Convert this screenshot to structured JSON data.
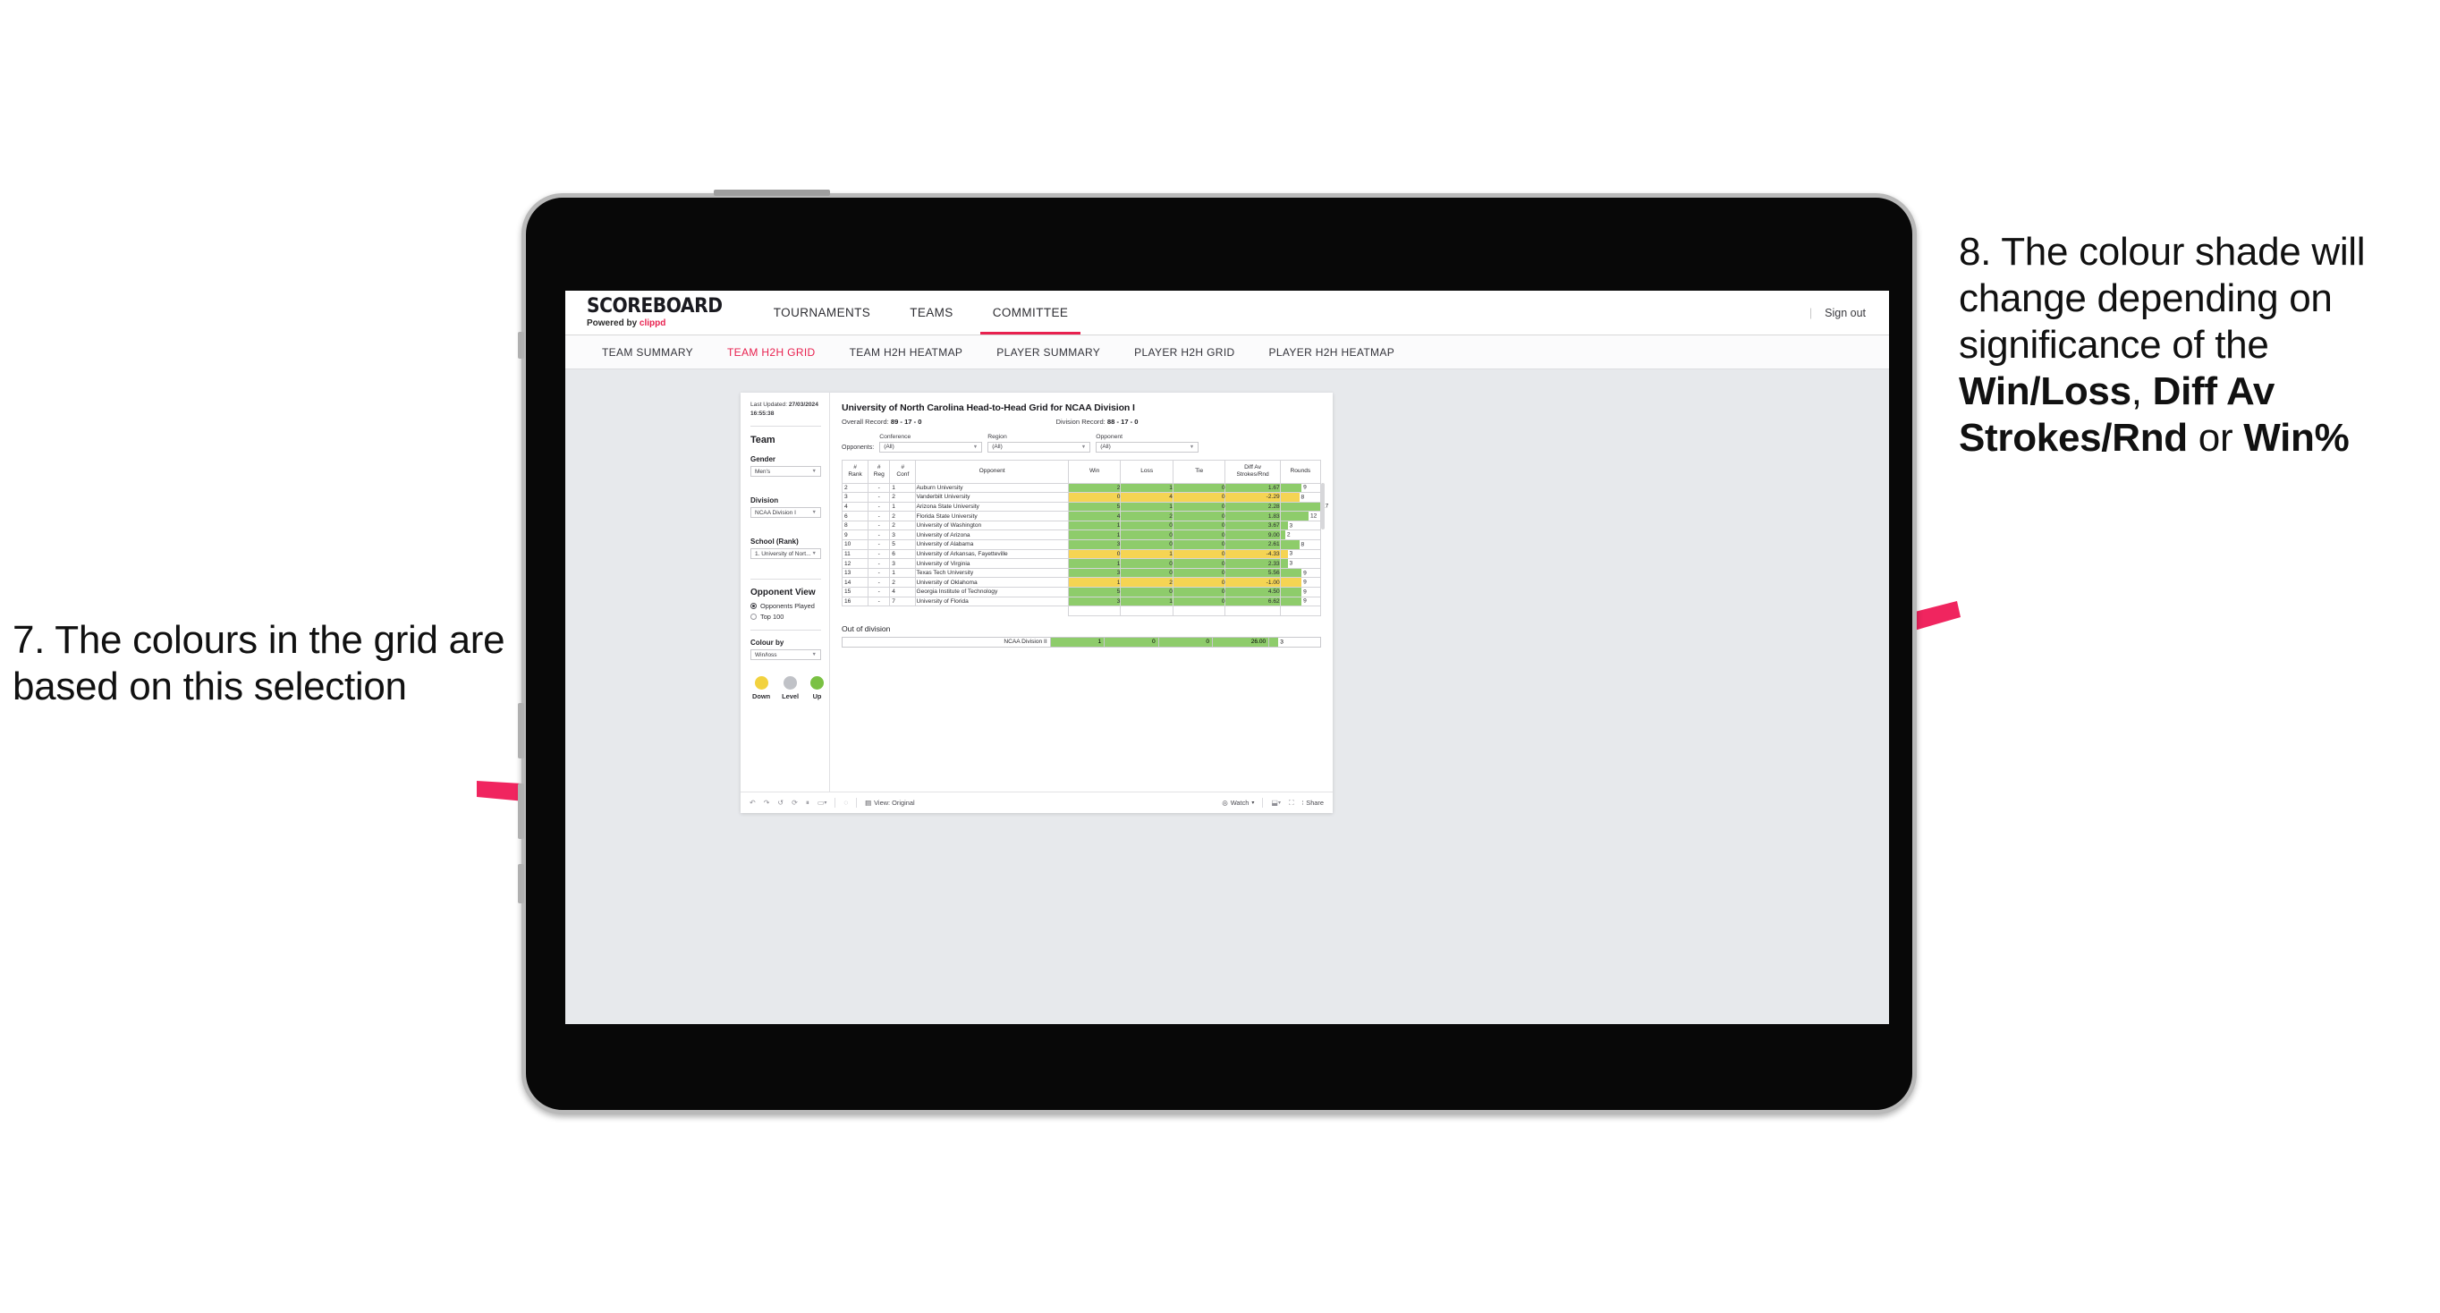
{
  "annotations": {
    "left": {
      "num": "7.",
      "text": "The colours in the grid are based on this selection"
    },
    "right_parts": [
      {
        "t": "8. The colour shade will change depending on significance of the ",
        "b": false
      },
      {
        "t": "Win/Loss",
        "b": true
      },
      {
        "t": ", ",
        "b": false
      },
      {
        "t": "Diff Av Strokes/Rnd",
        "b": true
      },
      {
        "t": " or ",
        "b": false
      },
      {
        "t": "Win%",
        "b": true
      }
    ],
    "arrow_color": "#F0255F"
  },
  "app": {
    "logo_main": "SCOREBOARD",
    "logo_sub_prefix": "Powered by ",
    "logo_brand": "clippd",
    "topnav": [
      {
        "label": "TOURNAMENTS",
        "active": false
      },
      {
        "label": "TEAMS",
        "active": false
      },
      {
        "label": "COMMITTEE",
        "active": true
      }
    ],
    "signout_divider": "|",
    "signout": "Sign out",
    "subnav": [
      {
        "label": "TEAM SUMMARY",
        "active": false
      },
      {
        "label": "TEAM H2H GRID",
        "active": true
      },
      {
        "label": "TEAM H2H HEATMAP",
        "active": false
      },
      {
        "label": "PLAYER SUMMARY",
        "active": false
      },
      {
        "label": "PLAYER H2H GRID",
        "active": false
      },
      {
        "label": "PLAYER H2H HEATMAP",
        "active": false
      }
    ],
    "accent": "#e8214f"
  },
  "sidebar": {
    "updated_label": "Last Updated: ",
    "updated_date": "27/03/2024",
    "updated_time": "16:55:38",
    "team_heading": "Team",
    "gender_label": "Gender",
    "gender_value": "Men's",
    "division_label": "Division",
    "division_value": "NCAA Division I",
    "school_label": "School (Rank)",
    "school_value": "1. University of Nort...",
    "opponent_view_heading": "Opponent View",
    "radios": [
      {
        "label": "Opponents Played",
        "selected": true
      },
      {
        "label": "Top 100",
        "selected": false
      }
    ],
    "colour_by_label": "Colour by",
    "colour_by_value": "Win/loss",
    "legend": [
      {
        "label": "Down",
        "color": "#f2d23f"
      },
      {
        "label": "Level",
        "color": "#c0c2c7"
      },
      {
        "label": "Up",
        "color": "#7ac143"
      }
    ]
  },
  "workbook": {
    "title": "University of North Carolina Head-to-Head Grid for NCAA Division I",
    "overall_label": "Overall Record: ",
    "overall_value": "89 - 17 - 0",
    "division_label": "Division Record: ",
    "division_value": "88 - 17 - 0",
    "opponents_label": "Opponents:",
    "filters": [
      {
        "label": "Conference",
        "value": "(All)"
      },
      {
        "label": "Region",
        "value": "(All)"
      },
      {
        "label": "Opponent",
        "value": "(All)"
      }
    ],
    "out_of_division_title": "Out of division",
    "toolbar": {
      "view_label": "View: Original",
      "watch_label": "Watch",
      "share_label": "Share"
    }
  },
  "chart_data": {
    "type": "table",
    "title": "University of North Carolina Head-to-Head Grid for NCAA Division I",
    "columns": [
      "# Rank",
      "# Reg",
      "# Conf",
      "Opponent",
      "Win",
      "Loss",
      "Tie",
      "Diff Av Strokes/Rnd",
      "Rounds"
    ],
    "column_headers_multiline": [
      [
        "#",
        "Rank"
      ],
      [
        "#",
        "Reg"
      ],
      [
        "#",
        "Conf"
      ],
      [
        "Opponent"
      ],
      [
        "Win"
      ],
      [
        "Loss"
      ],
      [
        "Tie"
      ],
      [
        "Diff Av",
        "Strokes/Rnd"
      ],
      [
        "Rounds"
      ]
    ],
    "rounds_max": 17,
    "colour_scale": {
      "up": "#8ecc6b",
      "down": "#f5d453",
      "level": "#c0c2c7"
    },
    "rows": [
      {
        "rank": "2",
        "reg": "-",
        "conf": "1",
        "opponent": "Auburn University",
        "win": "2",
        "loss": "1",
        "tie": "0",
        "diff": "1.67",
        "rounds": "9",
        "state": "up"
      },
      {
        "rank": "3",
        "reg": "-",
        "conf": "2",
        "opponent": "Vanderbilt University",
        "win": "0",
        "loss": "4",
        "tie": "0",
        "diff": "-2.29",
        "rounds": "8",
        "state": "down"
      },
      {
        "rank": "4",
        "reg": "-",
        "conf": "1",
        "opponent": "Arizona State University",
        "win": "5",
        "loss": "1",
        "tie": "0",
        "diff": "2.28",
        "rounds": "17",
        "state": "up"
      },
      {
        "rank": "6",
        "reg": "-",
        "conf": "2",
        "opponent": "Florida State University",
        "win": "4",
        "loss": "2",
        "tie": "0",
        "diff": "1.83",
        "rounds": "12",
        "state": "up"
      },
      {
        "rank": "8",
        "reg": "-",
        "conf": "2",
        "opponent": "University of Washington",
        "win": "1",
        "loss": "0",
        "tie": "0",
        "diff": "3.67",
        "rounds": "3",
        "state": "up"
      },
      {
        "rank": "9",
        "reg": "-",
        "conf": "3",
        "opponent": "University of Arizona",
        "win": "1",
        "loss": "0",
        "tie": "0",
        "diff": "9.00",
        "rounds": "2",
        "state": "up"
      },
      {
        "rank": "10",
        "reg": "-",
        "conf": "5",
        "opponent": "University of Alabama",
        "win": "3",
        "loss": "0",
        "tie": "0",
        "diff": "2.61",
        "rounds": "8",
        "state": "up"
      },
      {
        "rank": "11",
        "reg": "-",
        "conf": "6",
        "opponent": "University of Arkansas, Fayetteville",
        "win": "0",
        "loss": "1",
        "tie": "0",
        "diff": "-4.33",
        "rounds": "3",
        "state": "down"
      },
      {
        "rank": "12",
        "reg": "-",
        "conf": "3",
        "opponent": "University of Virginia",
        "win": "1",
        "loss": "0",
        "tie": "0",
        "diff": "2.33",
        "rounds": "3",
        "state": "up"
      },
      {
        "rank": "13",
        "reg": "-",
        "conf": "1",
        "opponent": "Texas Tech University",
        "win": "3",
        "loss": "0",
        "tie": "0",
        "diff": "5.56",
        "rounds": "9",
        "state": "up"
      },
      {
        "rank": "14",
        "reg": "-",
        "conf": "2",
        "opponent": "University of Oklahoma",
        "win": "1",
        "loss": "2",
        "tie": "0",
        "diff": "-1.00",
        "rounds": "9",
        "state": "down"
      },
      {
        "rank": "15",
        "reg": "-",
        "conf": "4",
        "opponent": "Georgia Institute of Technology",
        "win": "5",
        "loss": "0",
        "tie": "0",
        "diff": "4.50",
        "rounds": "9",
        "state": "up"
      },
      {
        "rank": "16",
        "reg": "-",
        "conf": "7",
        "opponent": "University of Florida",
        "win": "3",
        "loss": "1",
        "tie": "0",
        "diff": "6.62",
        "rounds": "9",
        "state": "up"
      }
    ],
    "out_of_division": [
      {
        "name": "NCAA Division II",
        "win": "1",
        "loss": "0",
        "tie": "0",
        "diff": "26.00",
        "rounds": "3",
        "state": "up"
      }
    ]
  }
}
